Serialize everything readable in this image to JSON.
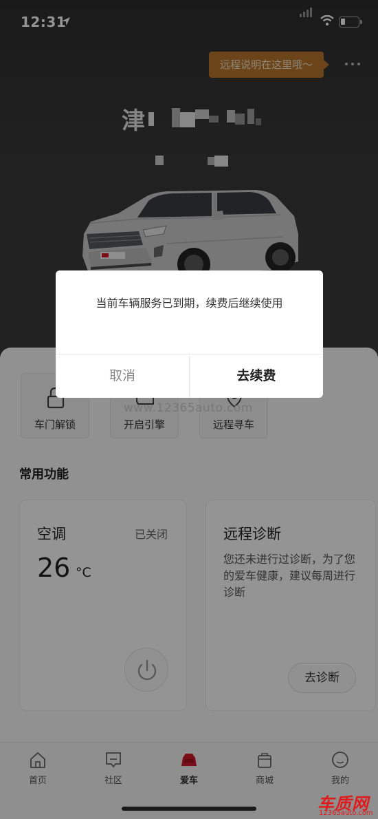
{
  "status_bar": {
    "time": "12:31"
  },
  "header": {
    "tooltip": "远程说明在这里哦～",
    "plate_prefix": "津"
  },
  "quick_actions": [
    {
      "label": "车门解锁",
      "icon": "lock-icon"
    },
    {
      "label": "开启引擎",
      "icon": "engine-icon"
    },
    {
      "label": "远程寻车",
      "icon": "locate-car-icon"
    }
  ],
  "watermark": "www.12365auto.com",
  "common_functions": {
    "title": "常用功能",
    "ac": {
      "title": "空调",
      "status": "已关闭",
      "temp": "26",
      "unit": "°C"
    },
    "diagnosis": {
      "title": "远程诊断",
      "text": "您还未进行过诊断，为了您的爱车健康，建议每周进行诊断",
      "button": "去诊断"
    }
  },
  "tabs": [
    {
      "label": "首页",
      "icon": "home-icon"
    },
    {
      "label": "社区",
      "icon": "community-icon"
    },
    {
      "label": "爱车",
      "icon": "car-icon",
      "active": true
    },
    {
      "label": "商城",
      "icon": "mall-icon"
    },
    {
      "label": "我的",
      "icon": "profile-icon"
    }
  ],
  "dialog": {
    "message": "当前车辆服务已到期，续费后继续使用",
    "cancel": "取消",
    "confirm": "去续费"
  },
  "brand": {
    "name": "车质网",
    "url": "12365auto.com"
  },
  "colors": {
    "tooltip_bg": "#b8772b",
    "active_tab": "#d0172d",
    "brand_red": "#e01b1b"
  }
}
